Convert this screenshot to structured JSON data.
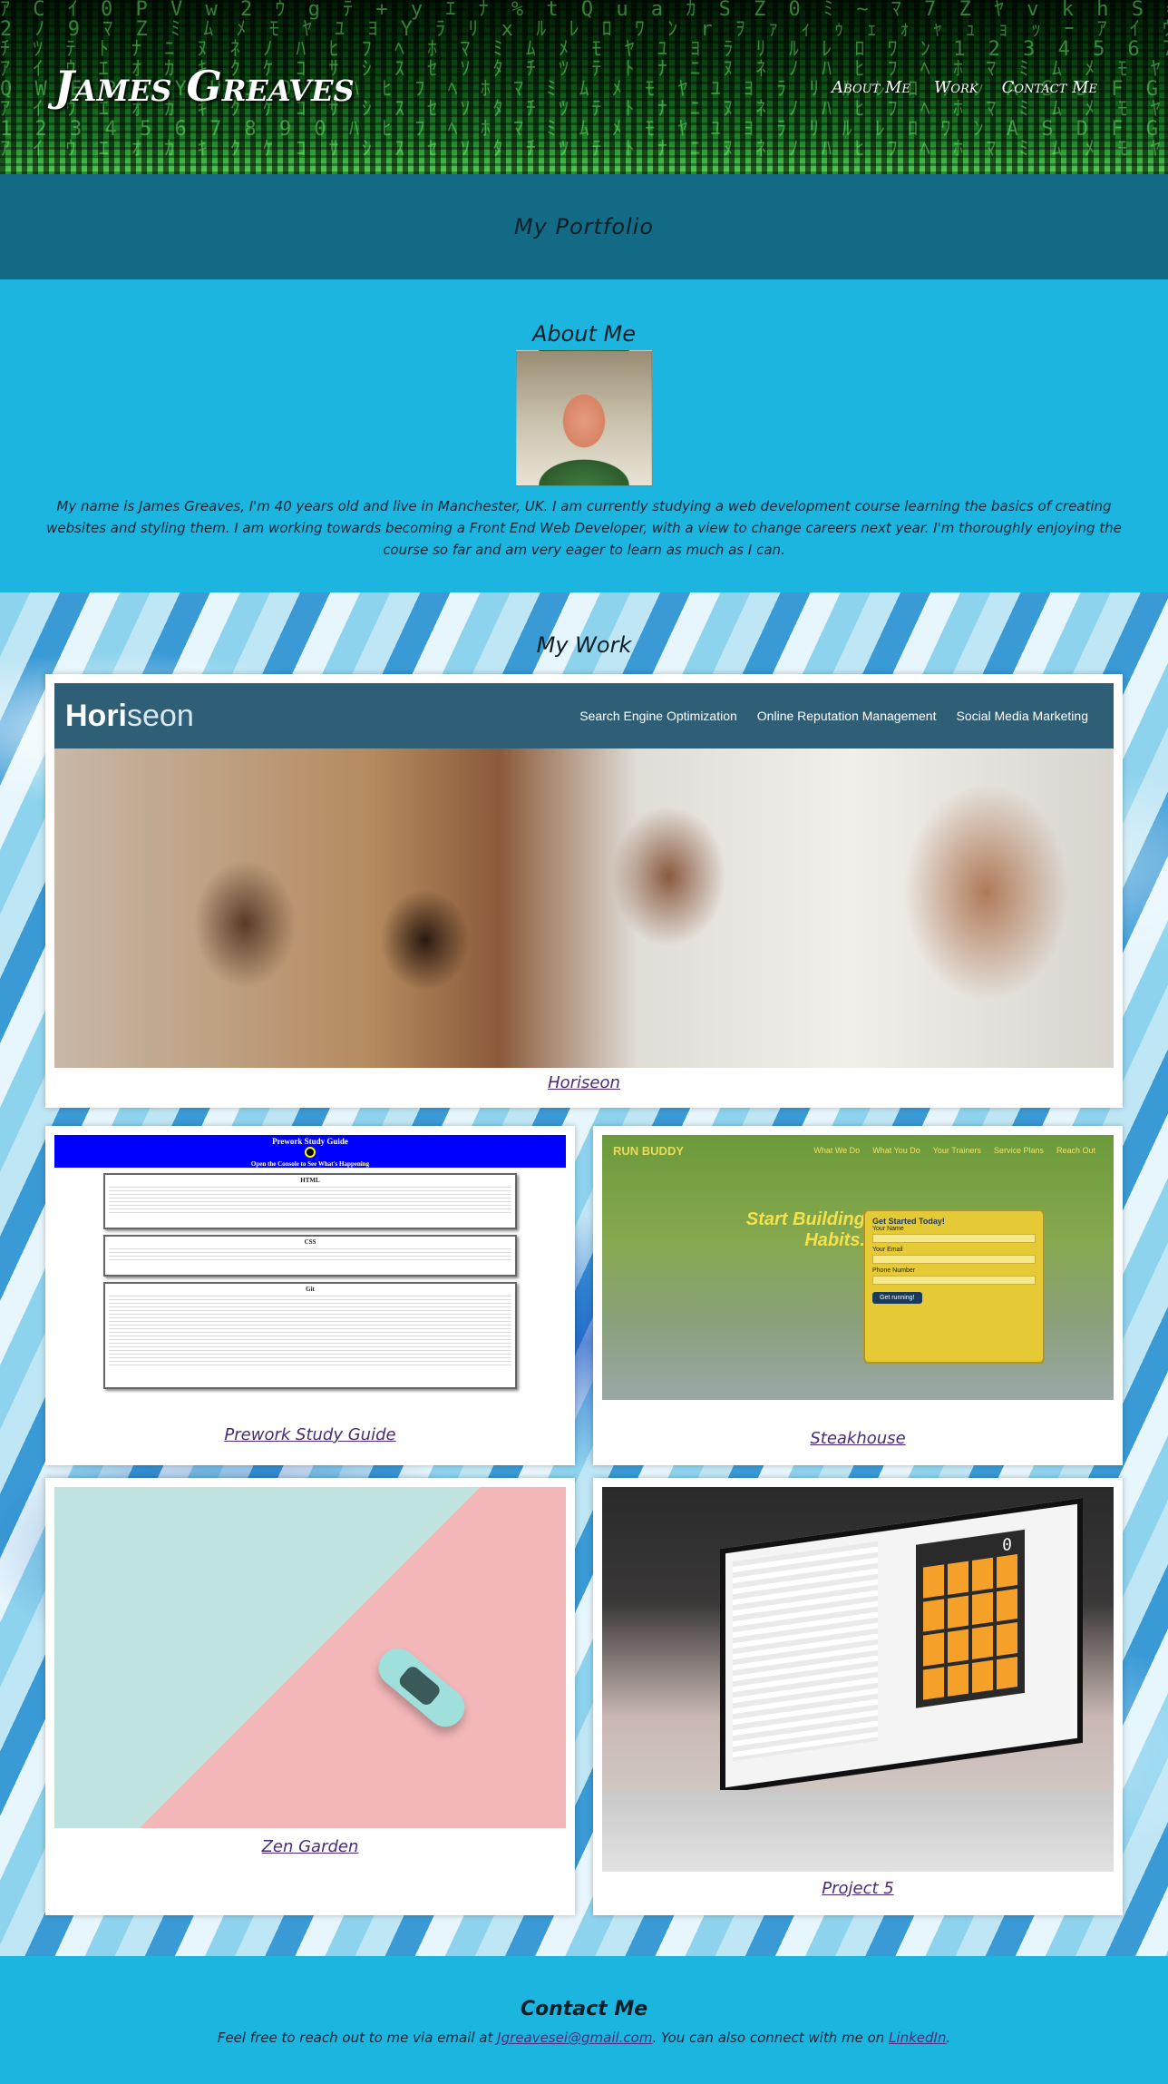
{
  "header": {
    "title": "James Greaves",
    "nav": [
      "About Me",
      "Work",
      "Contact Me"
    ]
  },
  "banner": {
    "title": "My Portfolio"
  },
  "about": {
    "heading": "About Me",
    "avatar_icon": "profile-photo",
    "bio": "My name is James Greaves, I'm 40 years old and live in Manchester, UK. I am currently studying a web development course learning the basics of creating websites and styling them. I am working towards becoming a Front End Web Developer, with a view to change careers next year. I'm thoroughly enjoying the course so far and am very eager to learn as much as I can."
  },
  "work": {
    "heading": "My Work",
    "projects": [
      {
        "label": "Horiseon"
      },
      {
        "label": "Prework Study Guide"
      },
      {
        "label": "Steakhouse"
      },
      {
        "label": "Zen Garden"
      },
      {
        "label": "Project 5"
      }
    ],
    "horiseon_shot": {
      "logo_a": "Hori",
      "logo_b": "seon",
      "nav": [
        "Search Engine Optimization",
        "Online Reputation Management",
        "Social Media Marketing"
      ]
    },
    "prework_shot": {
      "title": "Prework Study Guide",
      "subtitle": "Open the Console to See What's Happening",
      "sections": [
        "HTML",
        "CSS",
        "Git"
      ]
    },
    "runbuddy_shot": {
      "logo": "RUN BUDDY",
      "nav": [
        "What We Do",
        "What You Do",
        "Your Trainers",
        "Service Plans",
        "Reach Out"
      ],
      "hero": "Start Building Habits.",
      "form_title": "Get Started Today!",
      "fields": [
        "Your Name",
        "Your Email",
        "Phone Number"
      ],
      "button": "Get running!"
    },
    "project5_shot": {
      "display": "0"
    }
  },
  "contact": {
    "heading": "Contact Me",
    "text_before": "Feel free to reach out to me via email at ",
    "email": "Jgreavesei@gmail.com",
    "text_middle": ". You can also connect with me on ",
    "linkedin": "LinkedIn",
    "text_after": "."
  },
  "colors": {
    "accent": "#1bb5df",
    "banner": "#136a84",
    "link": "#4a2a7a"
  }
}
